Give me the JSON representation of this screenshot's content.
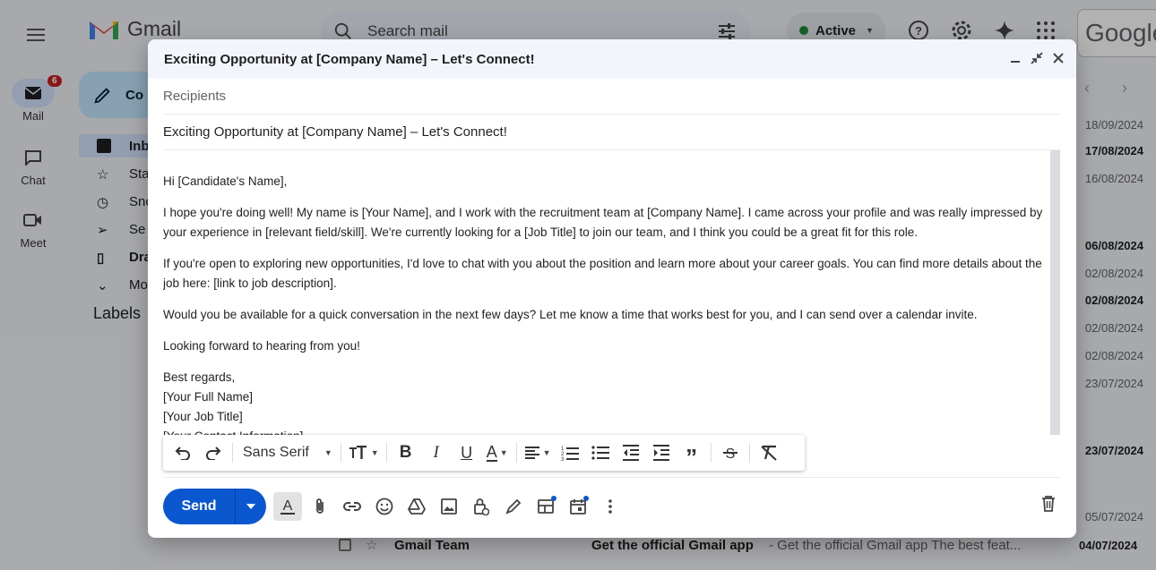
{
  "gmail": {
    "logo_text": "Gmail",
    "search_placeholder": "Search mail",
    "status": "Active",
    "google_text": "Google",
    "compose_label": "Co",
    "rail": [
      {
        "label": "Mail",
        "badge": "6"
      },
      {
        "label": "Chat"
      },
      {
        "label": "Meet"
      }
    ],
    "nav": [
      {
        "label": "Inb"
      },
      {
        "label": "Sta"
      },
      {
        "label": "Sno"
      },
      {
        "label": "Se"
      },
      {
        "label": "Dra"
      },
      {
        "label": "Mo"
      }
    ],
    "labels_heading": "Labels",
    "dates": [
      "18/09/2024",
      "17/08/2024",
      "16/08/2024",
      "06/08/2024",
      "02/08/2024",
      "02/08/2024",
      "02/08/2024",
      "02/08/2024",
      "23/07/2024",
      "23/07/2024",
      "05/07/2024"
    ],
    "last_row": {
      "sender": "Gmail Team",
      "subject": "Get the official Gmail app",
      "snippet": " - Get the official Gmail app The best feat...",
      "date": "04/07/2024"
    }
  },
  "compose": {
    "title": "Exciting Opportunity at [Company Name] – Let's Connect!",
    "recipients_placeholder": "Recipients",
    "subject": "Exciting Opportunity at [Company Name] – Let's Connect!",
    "body": {
      "greeting": "Hi [Candidate's Name],",
      "p1": "I hope you're doing well! My name is [Your Name], and I work with the recruitment team at [Company Name]. I came across your profile and was really impressed by your experience in [relevant field/skill]. We're currently looking for a [Job Title] to join our team, and I think you could be a great fit for this role.",
      "p2": "If you're open to exploring new opportunities, I'd love to chat with you about the position and learn more about your career goals. You can find more details about the job here: [link to job description].",
      "p3": "Would you be available for a quick conversation in the next few days? Let me know a time that works best for you, and I can send over a calendar invite.",
      "p4": "Looking forward to hearing from you!",
      "signoff": "Best regards,",
      "sig_name": "[Your Full Name]",
      "sig_title": "[Your Job Title]",
      "sig_contact": "[Your Contact Information]"
    },
    "toolbar": {
      "font": "Sans Serif"
    },
    "send_label": "Send"
  }
}
